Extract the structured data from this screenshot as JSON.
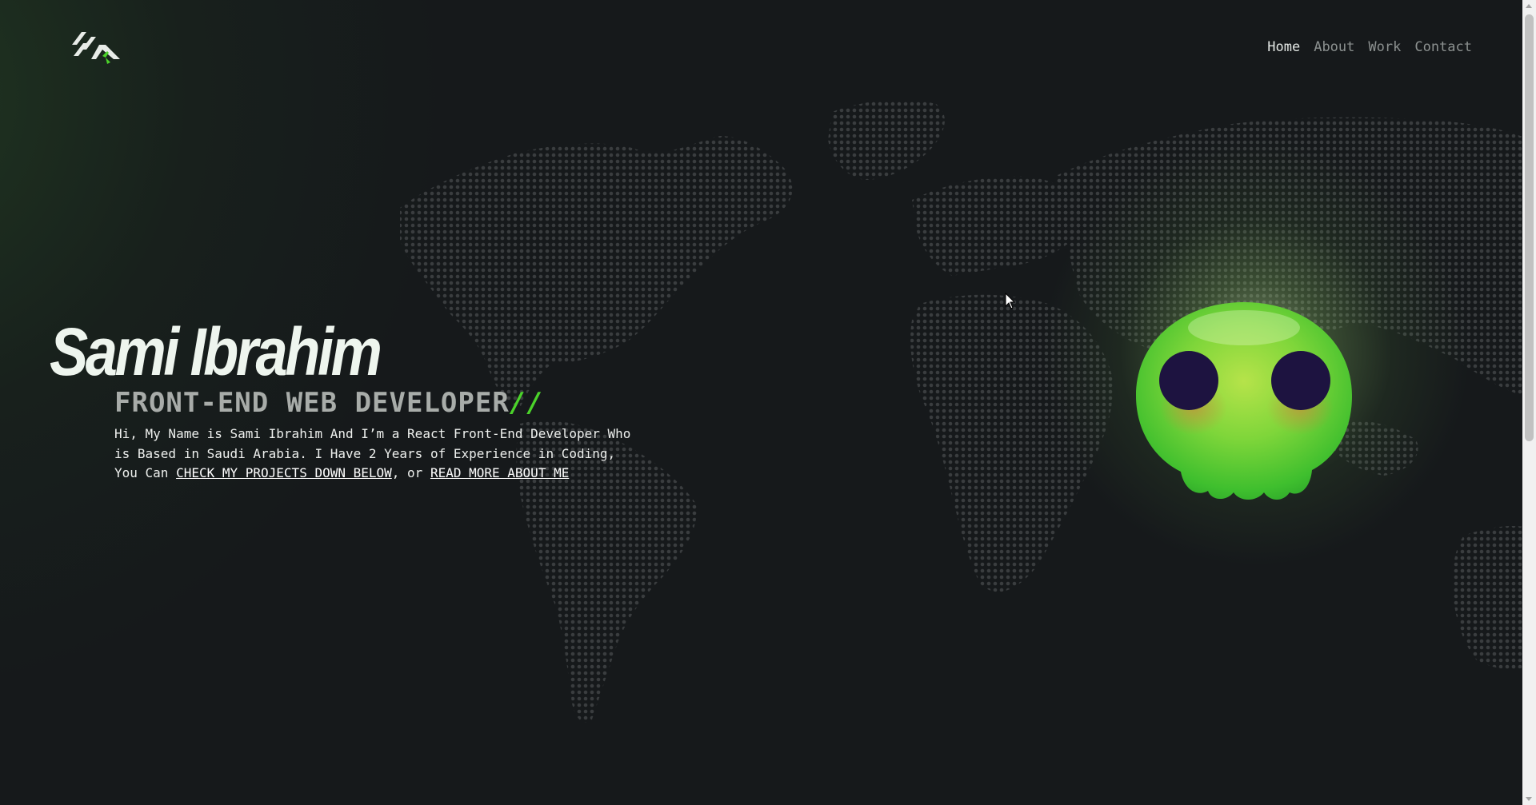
{
  "header": {
    "logo_icon": "sk-logo-icon",
    "nav": {
      "home": "Home",
      "about": "About",
      "work": "Work",
      "contact": "Contact",
      "active": "Home"
    }
  },
  "hero": {
    "name": "Sami Ibrahim",
    "role": "FRONT-END WEB DEVELOPER",
    "role_accent": "//",
    "intro": {
      "line_1": "Hi, My Name is Sami Ibrahim And I’m a React Front-End Developer Who is Based in Saudi Arabia. I Have 2 Years of Experience in Coding, You Can ",
      "projects_link": "CHECK MY PROJECTS DOWN BELOW",
      "middle": ", or ",
      "about_link": "READ MORE ABOUT ME"
    }
  },
  "decor": {
    "background_map": "world-dot-map",
    "mascot": "green-skull-blob",
    "accent_color": "#4bd32a",
    "background_color": "#16191b"
  }
}
